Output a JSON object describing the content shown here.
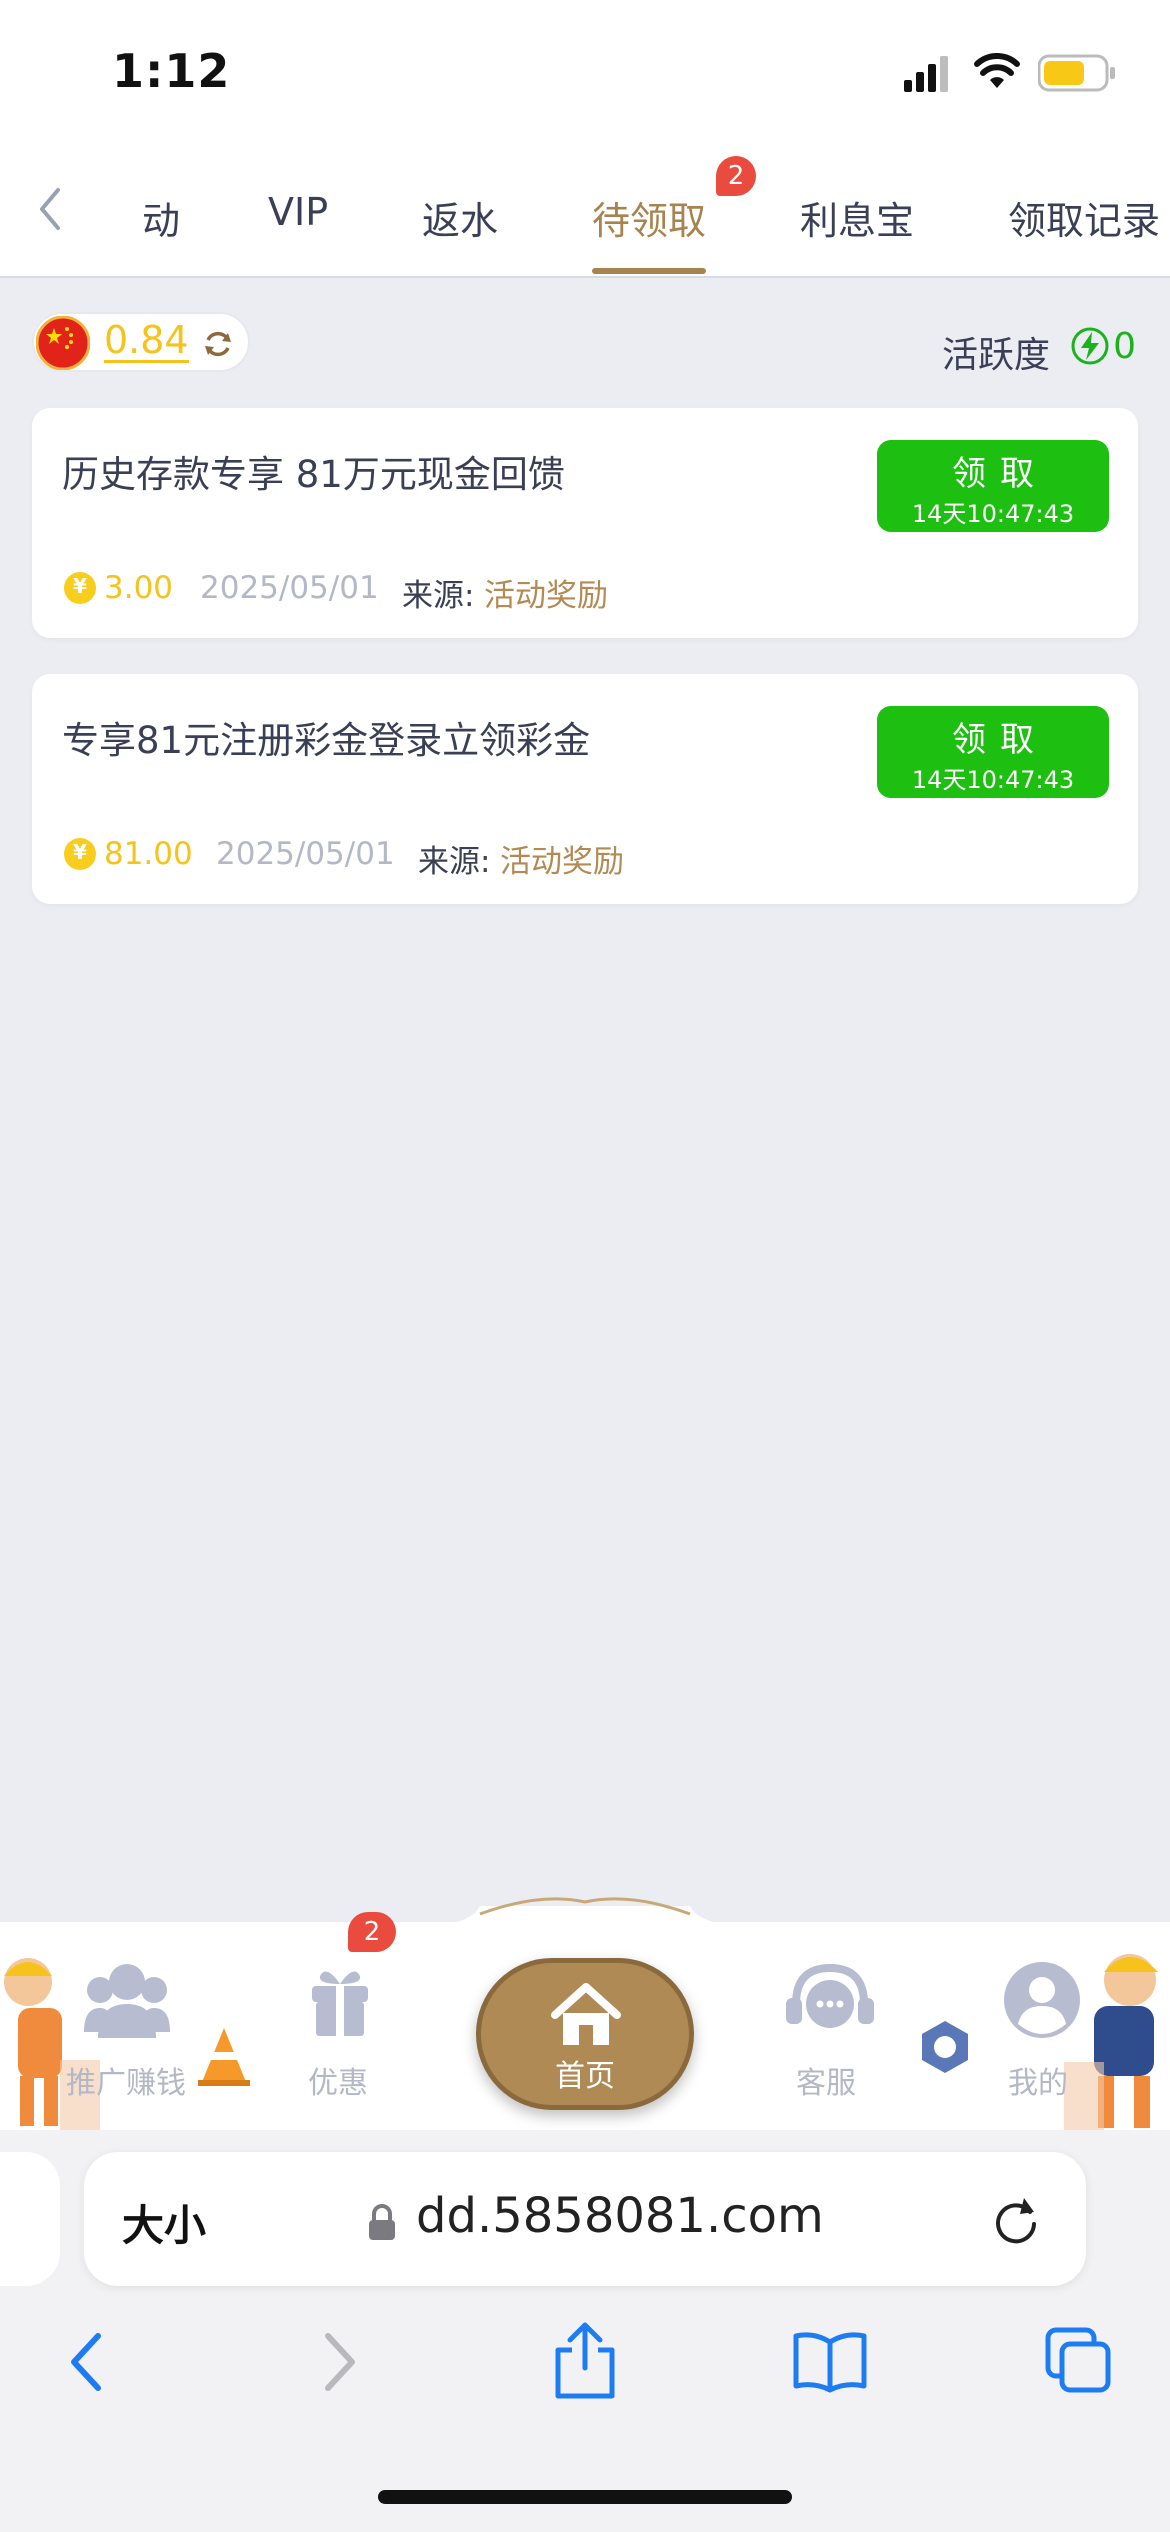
{
  "status_bar": {
    "time": "1:12"
  },
  "tabs": [
    {
      "label": "活动",
      "visible_text": "动"
    },
    {
      "label": "VIP"
    },
    {
      "label": "返水"
    },
    {
      "label": "待领取",
      "badge": "2",
      "active": true
    },
    {
      "label": "利息宝"
    },
    {
      "label": "领取记录"
    }
  ],
  "balance": {
    "value": "0.84"
  },
  "activity": {
    "label": "活跃度",
    "value": "0"
  },
  "rewards": [
    {
      "title": "历史存款专享 81万元现金回馈",
      "claim_label": "领取",
      "countdown": "14天10:47:43",
      "amount": "3.00",
      "date": "2025/05/01",
      "source_label": "来源:",
      "source_value": "活动奖励"
    },
    {
      "title": "专享81元注册彩金登录立领彩金",
      "claim_label": "领取",
      "countdown": "14天10:47:43",
      "amount": "81.00",
      "date": "2025/05/01",
      "source_label": "来源:",
      "source_value": "活动奖励"
    }
  ],
  "bottom_nav": {
    "promote": "推广赚钱",
    "offers": "优惠",
    "offers_badge": "2",
    "home": "首页",
    "service": "客服",
    "mine": "我的"
  },
  "browser": {
    "text_size": "大小",
    "url": "dd.5858081.com"
  },
  "colors": {
    "accent_gold": "#a7834f",
    "claim_green": "#1dbf10",
    "coin_yellow": "#f6c21c",
    "badge_red": "#ea4b3f",
    "background": "#ebedf2"
  }
}
